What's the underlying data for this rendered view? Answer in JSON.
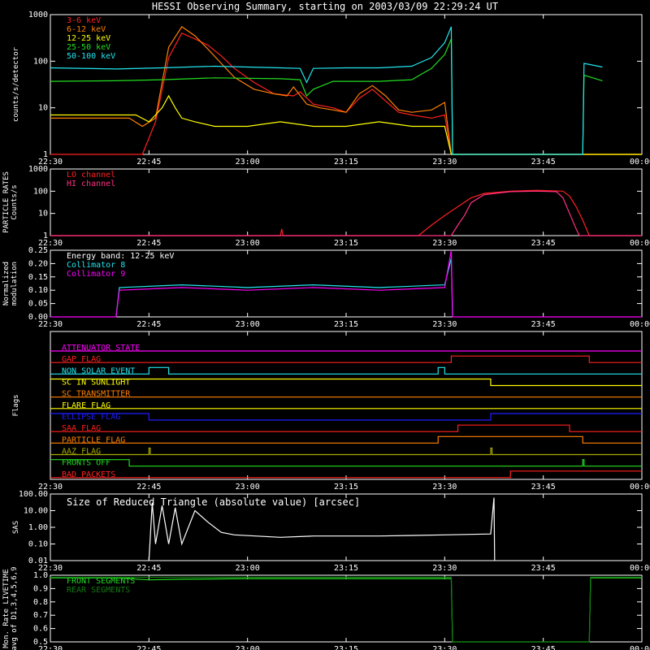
{
  "title": "HESSI Observing Summary, starting on 2003/03/09 22:29:24 UT",
  "time_ticks": [
    "22:30",
    "22:45",
    "23:00",
    "23:15",
    "23:30",
    "23:45",
    "00:00"
  ],
  "colors": {
    "red": "#ff2020",
    "orange": "#ff8000",
    "yellow": "#ffff00",
    "green": "#22dd22",
    "cyan": "#22e5ee",
    "magenta": "#ff00ff",
    "white": "#ffffff",
    "blue": "#1c1cff",
    "olive": "#a8a800"
  },
  "chart_data": [
    {
      "id": "rates",
      "type": "line",
      "ylabel": "counts/s/detector",
      "yscale": "log",
      "ylim": [
        1,
        1000
      ],
      "yticks": [
        "1",
        "10",
        "100",
        "1000"
      ],
      "series": [
        {
          "name": "3-6 keV",
          "color": "#ff2020",
          "points": [
            [
              0,
              1
            ],
            [
              12,
              1
            ],
            [
              14,
              1
            ],
            [
              16,
              5
            ],
            [
              18,
              120
            ],
            [
              20,
              400
            ],
            [
              22,
              300
            ],
            [
              24,
              220
            ],
            [
              26,
              130
            ],
            [
              28,
              70
            ],
            [
              31,
              35
            ],
            [
              34,
              20
            ],
            [
              37,
              18
            ],
            [
              38,
              22
            ],
            [
              40,
              12
            ],
            [
              43,
              10
            ],
            [
              45,
              8
            ],
            [
              47,
              16
            ],
            [
              49,
              25
            ],
            [
              51,
              14
            ],
            [
              53,
              8
            ],
            [
              55,
              7
            ],
            [
              58,
              6
            ],
            [
              60,
              7
            ],
            [
              61,
              1
            ],
            [
              90,
              1
            ]
          ]
        },
        {
          "name": "6-12 keV",
          "color": "#ff8000",
          "points": [
            [
              0,
              6
            ],
            [
              12,
              6
            ],
            [
              14,
              4
            ],
            [
              16,
              6
            ],
            [
              18,
              200
            ],
            [
              20,
              550
            ],
            [
              22,
              350
            ],
            [
              24,
              180
            ],
            [
              26,
              90
            ],
            [
              28,
              45
            ],
            [
              31,
              25
            ],
            [
              34,
              20
            ],
            [
              36,
              18
            ],
            [
              37,
              28
            ],
            [
              39,
              12
            ],
            [
              41,
              10
            ],
            [
              43,
              9
            ],
            [
              45,
              8
            ],
            [
              47,
              20
            ],
            [
              49,
              30
            ],
            [
              51,
              18
            ],
            [
              53,
              9
            ],
            [
              55,
              8
            ],
            [
              58,
              9
            ],
            [
              60,
              13
            ],
            [
              61,
              1
            ],
            [
              90,
              1
            ]
          ]
        },
        {
          "name": "12-25 keV",
          "color": "#ffff00",
          "points": [
            [
              0,
              7
            ],
            [
              13,
              7
            ],
            [
              15,
              5
            ],
            [
              16,
              7
            ],
            [
              17,
              10
            ],
            [
              18,
              18
            ],
            [
              19,
              10
            ],
            [
              20,
              6
            ],
            [
              22,
              5
            ],
            [
              25,
              4
            ],
            [
              30,
              4
            ],
            [
              35,
              5
            ],
            [
              40,
              4
            ],
            [
              45,
              4
            ],
            [
              50,
              5
            ],
            [
              55,
              4
            ],
            [
              60,
              4
            ],
            [
              61,
              1
            ],
            [
              90,
              1
            ]
          ]
        },
        {
          "name": "25-50 keV",
          "color": "#22dd22",
          "points": [
            [
              0,
              37
            ],
            [
              10,
              38
            ],
            [
              17,
              40
            ],
            [
              25,
              44
            ],
            [
              35,
              42
            ],
            [
              38,
              40
            ],
            [
              39,
              18
            ],
            [
              40,
              25
            ],
            [
              43,
              37
            ],
            [
              50,
              37
            ],
            [
              55,
              40
            ],
            [
              58,
              70
            ],
            [
              60,
              140
            ],
            [
              61,
              300
            ],
            [
              61.2,
              1
            ],
            [
              81,
              1
            ],
            [
              81.2,
              50
            ],
            [
              84,
              38
            ]
          ]
        },
        {
          "name": "50-100 keV",
          "color": "#22e5ee",
          "points": [
            [
              0,
              72
            ],
            [
              10,
              68
            ],
            [
              17,
              72
            ],
            [
              25,
              78
            ],
            [
              35,
              72
            ],
            [
              38,
              70
            ],
            [
              39,
              35
            ],
            [
              40,
              70
            ],
            [
              45,
              72
            ],
            [
              50,
              72
            ],
            [
              55,
              78
            ],
            [
              58,
              120
            ],
            [
              60,
              250
            ],
            [
              61,
              550
            ],
            [
              61.2,
              1
            ],
            [
              81,
              1
            ],
            [
              81.2,
              90
            ],
            [
              84,
              75
            ]
          ]
        }
      ]
    },
    {
      "id": "particle",
      "type": "line",
      "ylabel": "PARTICLE RATES",
      "ylabel2": "Counts/s",
      "yscale": "log",
      "ylim": [
        1,
        1000
      ],
      "yticks": [
        "1",
        "10",
        "100",
        "1000"
      ],
      "series": [
        {
          "name": "LO channel",
          "color": "#ff2020",
          "points": [
            [
              0,
              1
            ],
            [
              35,
              1
            ],
            [
              35.2,
              2
            ],
            [
              35.4,
              1
            ],
            [
              56,
              1
            ],
            [
              58,
              3
            ],
            [
              60,
              8
            ],
            [
              62,
              20
            ],
            [
              64,
              50
            ],
            [
              66,
              80
            ],
            [
              70,
              100
            ],
            [
              74,
              110
            ],
            [
              78,
              100
            ],
            [
              79,
              60
            ],
            [
              80,
              20
            ],
            [
              81,
              5
            ],
            [
              82,
              1
            ],
            [
              90,
              1
            ]
          ]
        },
        {
          "name": "HI channel",
          "color": "#ff3080",
          "points": [
            [
              0,
              1
            ],
            [
              61,
              1
            ],
            [
              62,
              3
            ],
            [
              63,
              8
            ],
            [
              64,
              30
            ],
            [
              66,
              70
            ],
            [
              70,
              95
            ],
            [
              74,
              100
            ],
            [
              77,
              95
            ],
            [
              78,
              50
            ],
            [
              79,
              10
            ],
            [
              80,
              2
            ],
            [
              80.5,
              1
            ],
            [
              90,
              1
            ]
          ]
        }
      ]
    },
    {
      "id": "modulation",
      "type": "line",
      "ylabel": "Normalized",
      "ylabel2": "modulation",
      "ylim": [
        0,
        0.25
      ],
      "yticks": [
        "0.00",
        "0.05",
        "0.10",
        "0.15",
        "0.20",
        "0.25"
      ],
      "annotation": "Energy band: 12-25 keV",
      "series": [
        {
          "name": "Collimator 8",
          "color": "#22e5ee",
          "points": [
            [
              10,
              0
            ],
            [
              10.5,
              0.11
            ],
            [
              20,
              0.12
            ],
            [
              30,
              0.11
            ],
            [
              40,
              0.12
            ],
            [
              50,
              0.11
            ],
            [
              60,
              0.12
            ],
            [
              61,
              0.22
            ],
            [
              61.2,
              0
            ]
          ]
        },
        {
          "name": "Collimator 9",
          "color": "#ff00ff",
          "points": [
            [
              0,
              0
            ],
            [
              10,
              0
            ],
            [
              10.5,
              0.1
            ],
            [
              20,
              0.11
            ],
            [
              30,
              0.1
            ],
            [
              40,
              0.11
            ],
            [
              50,
              0.1
            ],
            [
              60,
              0.11
            ],
            [
              61,
              0.25
            ],
            [
              61.2,
              0
            ],
            [
              90,
              0
            ]
          ]
        }
      ]
    },
    {
      "id": "flags",
      "type": "line",
      "ylabel": "Flags",
      "flags": [
        {
          "name": "ATTENUATOR STATE",
          "color": "#ff00ff",
          "steps": [
            [
              0,
              0
            ]
          ]
        },
        {
          "name": "GAP FLAG",
          "color": "#ff2020",
          "steps": [
            [
              0,
              0
            ],
            [
              61,
              1
            ],
            [
              82,
              0
            ]
          ]
        },
        {
          "name": "NON SOLAR EVENT",
          "color": "#22e5ee",
          "steps": [
            [
              0,
              0
            ],
            [
              15,
              1
            ],
            [
              18,
              0
            ],
            [
              59,
              1
            ],
            [
              60,
              0
            ]
          ]
        },
        {
          "name": "SC IN SUNLIGHT",
          "color": "#ffff00",
          "steps": [
            [
              0,
              1
            ],
            [
              67,
              0
            ]
          ]
        },
        {
          "name": "SC TRANSMITTER",
          "color": "#ff8000",
          "steps": [
            [
              0,
              0
            ]
          ]
        },
        {
          "name": "FLARE FLAG",
          "color": "#ffff00",
          "steps": [
            [
              0,
              0
            ]
          ]
        },
        {
          "name": "ECLIPSE FLAG",
          "color": "#1c1cff",
          "steps": [
            [
              0,
              1
            ],
            [
              15,
              0
            ],
            [
              67,
              1
            ]
          ]
        },
        {
          "name": "SAA FLAG",
          "color": "#ff2020",
          "steps": [
            [
              0,
              0
            ],
            [
              62,
              1
            ],
            [
              79,
              0
            ]
          ]
        },
        {
          "name": "PARTICLE FLAG",
          "color": "#ff8000",
          "steps": [
            [
              0,
              0
            ],
            [
              59,
              1
            ],
            [
              81,
              0
            ]
          ]
        },
        {
          "name": "AAZ FLAG",
          "color": "#a8a800",
          "steps": [
            [
              0,
              0
            ],
            [
              15,
              1
            ],
            [
              15.2,
              0
            ],
            [
              67,
              1
            ],
            [
              67.2,
              0
            ]
          ]
        },
        {
          "name": "FRONTS OFF",
          "color": "#22dd22",
          "steps": [
            [
              0,
              1
            ],
            [
              12,
              0
            ],
            [
              81,
              1
            ],
            [
              81.2,
              0
            ]
          ]
        },
        {
          "name": "BAD PACKETS",
          "color": "#ff2020",
          "steps": [
            [
              0,
              0
            ],
            [
              70,
              1
            ]
          ]
        }
      ]
    },
    {
      "id": "sas",
      "type": "line",
      "ylabel": "SAS",
      "yscale": "log",
      "ylim": [
        0.01,
        100
      ],
      "yticks": [
        "0.01",
        "0.10",
        "1.00",
        "10.00",
        "100.00"
      ],
      "annotation": "Size of Reduced Triangle (absolute value) [arcsec]",
      "series": [
        {
          "name": "",
          "color": "#ffffff",
          "points": [
            [
              15,
              0.01
            ],
            [
              15.5,
              30
            ],
            [
              16,
              0.1
            ],
            [
              17,
              20
            ],
            [
              18,
              0.1
            ],
            [
              19,
              15
            ],
            [
              20,
              0.1
            ],
            [
              22,
              10
            ],
            [
              24,
              2
            ],
            [
              26,
              0.5
            ],
            [
              28,
              0.35
            ],
            [
              35,
              0.25
            ],
            [
              40,
              0.3
            ],
            [
              50,
              0.3
            ],
            [
              60,
              0.35
            ],
            [
              67,
              0.4
            ],
            [
              67.5,
              60
            ],
            [
              67.6,
              0.01
            ]
          ]
        }
      ]
    },
    {
      "id": "livetime",
      "type": "line",
      "ylabel": "Mon. Rate LIVETIME",
      "ylabel2": "avg of D1,3,4,5,6,9",
      "ylim": [
        0.5,
        1.0
      ],
      "yticks": [
        "0.5",
        "0.6",
        "0.7",
        "0.8",
        "0.9",
        "1.0"
      ],
      "series": [
        {
          "name": "FRONT SEGMENTS",
          "color": "#22dd22",
          "points": [
            [
              0,
              0.98
            ],
            [
              10,
              0.98
            ],
            [
              15,
              0.965
            ],
            [
              20,
              0.97
            ],
            [
              30,
              0.975
            ],
            [
              60,
              0.975
            ],
            [
              61,
              0.975
            ],
            [
              61.2,
              0.5
            ],
            [
              82,
              0.5
            ],
            [
              82.2,
              0.98
            ],
            [
              90,
              0.98
            ]
          ]
        },
        {
          "name": "REAR SEGMENTS",
          "color": "#127a12",
          "points": [
            [
              0,
              0.985
            ],
            [
              61,
              0.985
            ],
            [
              61.2,
              0.5
            ],
            [
              82,
              0.5
            ],
            [
              82.2,
              0.985
            ],
            [
              90,
              0.985
            ]
          ]
        }
      ]
    }
  ]
}
